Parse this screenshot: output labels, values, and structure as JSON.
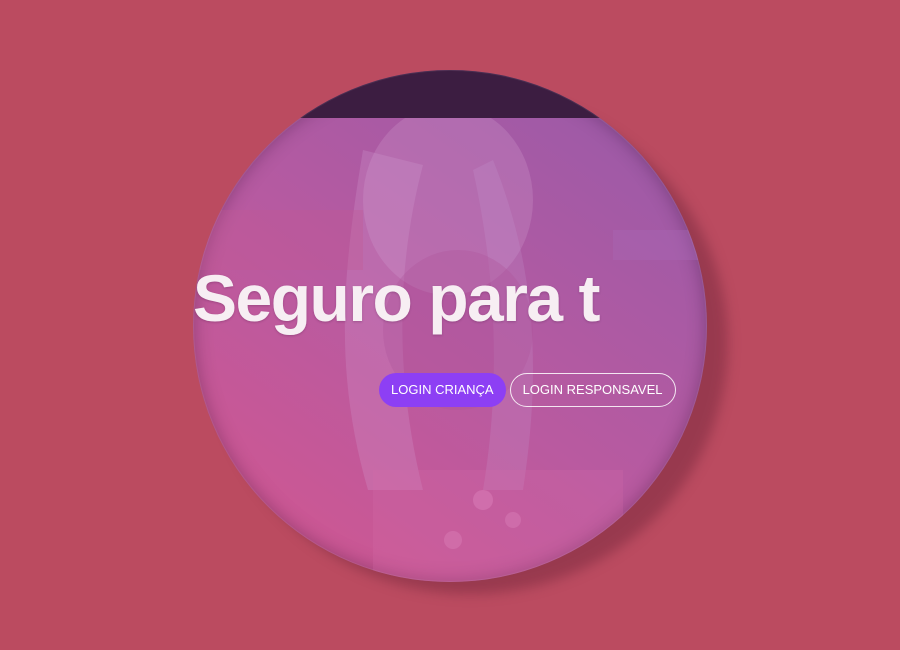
{
  "hero": {
    "headline": "Seguro para t",
    "buttons": {
      "child_login": "LOGIN CRIANÇA",
      "guardian_login": "LOGIN RESPONSAVEL"
    }
  },
  "colors": {
    "page_background": "#bb4b60",
    "topbar": "#3c1d41",
    "primary_button": "#8d3ff4",
    "overlay_pink": "#d4568e",
    "overlay_purple": "#955aa9"
  }
}
